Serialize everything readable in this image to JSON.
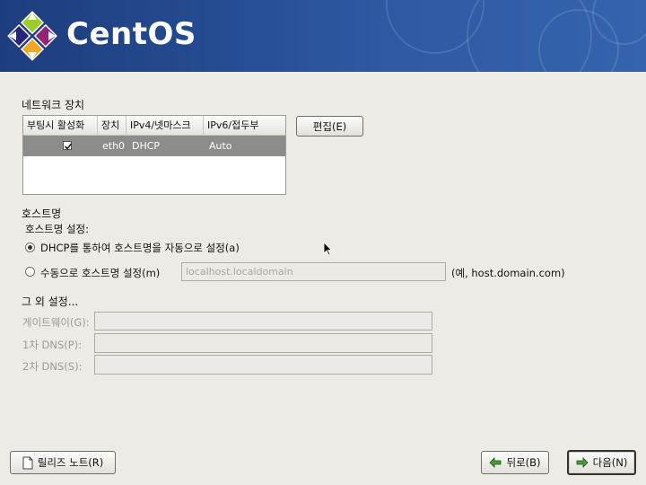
{
  "brand": {
    "name": "CentOS"
  },
  "network": {
    "section_title": "네트워크 장치",
    "columns": [
      "부팅시 활성화",
      "장치",
      "IPv4/넷마스크",
      "IPv6/접두부"
    ],
    "rows": [
      {
        "active": true,
        "device": "eth0",
        "ipv4": "DHCP",
        "ipv6": "Auto"
      }
    ],
    "edit_button": "편집(E)"
  },
  "hostname": {
    "section_title": "호스트명",
    "settings_label": "호스트명 설정:",
    "dhcp_option": "DHCP를 통하여 호스트명을 자동으로 설정(a)",
    "manual_option": "수동으로 호스트명 설정(m)",
    "manual_value": "localhost.localdomain",
    "example": "(예, host.domain.com)",
    "selected": "dhcp"
  },
  "other": {
    "section_title": "그 외 설정...",
    "gateway_label": "게이트웨이(G):",
    "dns1_label": "1차 DNS(P):",
    "dns2_label": "2차 DNS(S):",
    "gateway_value": "",
    "dns1_value": "",
    "dns2_value": ""
  },
  "footer": {
    "release_notes": "릴리즈 노트(R)",
    "back": "뒤로(B)",
    "next": "다음(N)"
  },
  "colors": {
    "banner": "#2a4f96",
    "selected_row": "#8c8c8a",
    "background": "#edebe6"
  }
}
